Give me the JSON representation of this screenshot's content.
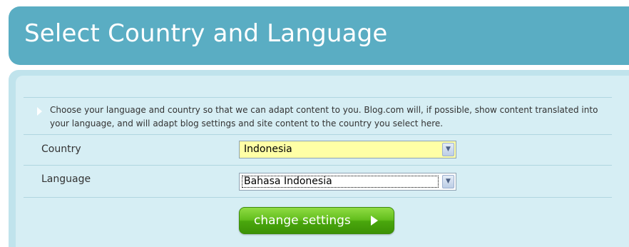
{
  "header": {
    "title": "Select Country and Language"
  },
  "intro": {
    "text": "Choose your language and country so that we can adapt content to you. Blog.com will, if possible, show content translated into your language, and will adapt blog settings and site content to the country you select here."
  },
  "form": {
    "country_label": "Country",
    "country_value": "Indonesia",
    "language_label": "Language",
    "language_value": "Bahasa Indonesia",
    "submit_label": "change settings"
  },
  "icons": {
    "select_arrow": "chevron-down-icon",
    "button_arrow": "play-arrow-icon",
    "intro_bullet": "bullet-arrow-icon"
  }
}
